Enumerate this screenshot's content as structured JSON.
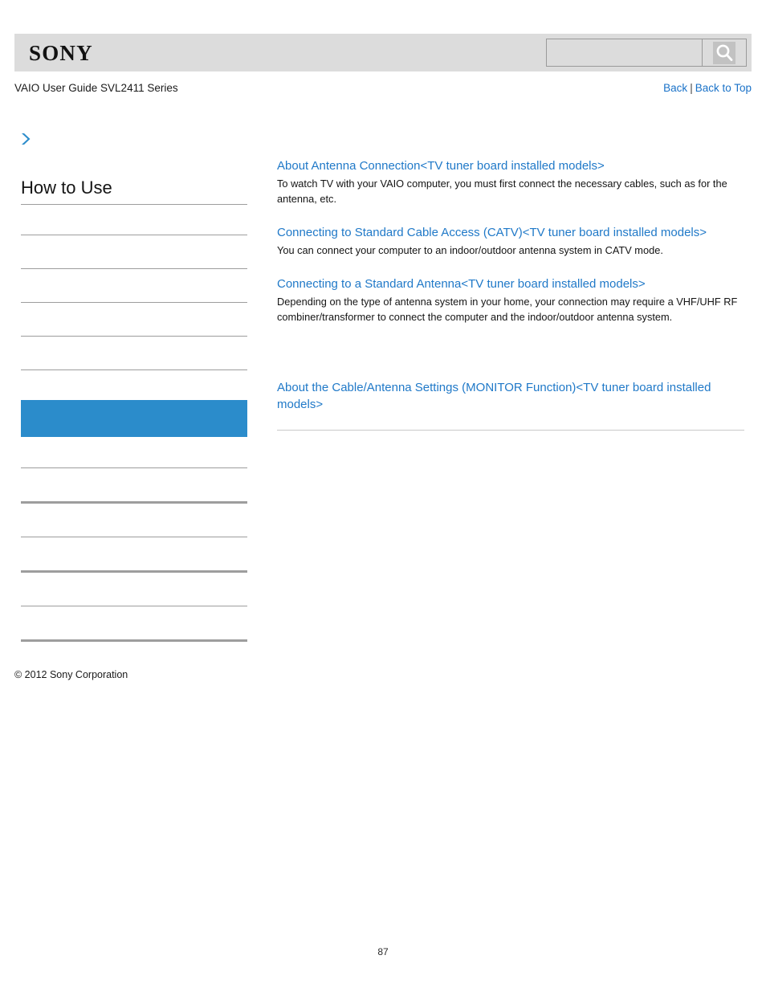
{
  "header": {
    "logo_text": "SONY",
    "search": {
      "value": "",
      "placeholder": "",
      "button_icon": "search-icon"
    }
  },
  "subheader": {
    "title": "VAIO User Guide SVL2411 Series",
    "back_label": "Back",
    "separator": "|",
    "back_to_top_label": "Back to Top"
  },
  "sidebar": {
    "breadcrumb_icon": "chevron-right-icon",
    "heading": "How to Use",
    "items": [
      {
        "label": "",
        "divider": "thin"
      },
      {
        "label": "",
        "divider": "thin"
      },
      {
        "label": "",
        "divider": "thin"
      },
      {
        "label": "",
        "divider": "thin"
      },
      {
        "label": "",
        "divider": "none",
        "current": true
      },
      {
        "label": "",
        "divider": "thin"
      },
      {
        "label": "",
        "divider": "thick"
      },
      {
        "label": "",
        "divider": "thin"
      },
      {
        "label": "",
        "divider": "thick"
      },
      {
        "label": "",
        "divider": "thin"
      },
      {
        "label": "",
        "divider": "thick"
      }
    ],
    "highlight_color": "#2b8ccb"
  },
  "main": {
    "topics": [
      {
        "link": "About Antenna Connection<TV tuner board installed models>",
        "description": "To watch TV with your VAIO computer, you must first connect the necessary cables, such as for the antenna, etc."
      },
      {
        "link": "Connecting to Standard Cable Access (CATV)<TV tuner board installed models>",
        "description": "You can connect your computer to an indoor/outdoor antenna system in CATV mode."
      },
      {
        "link": "Connecting to a Standard Antenna<TV tuner board installed models>",
        "description": "Depending on the type of antenna system in your home, your connection may require a VHF/UHF RF combiner/transformer to connect the computer and the indoor/outdoor antenna system."
      },
      {
        "link": "About the Cable/Antenna Settings (MONITOR Function)<TV tuner board installed models>",
        "description": ""
      }
    ]
  },
  "footer": {
    "copyright": "© 2012 Sony Corporation",
    "page_number": "87"
  }
}
